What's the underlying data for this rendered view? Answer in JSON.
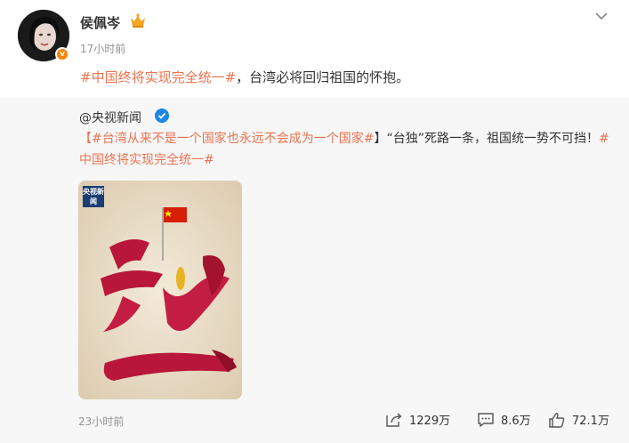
{
  "post": {
    "username": "侯佩岑",
    "time": "17小时前",
    "text_hashtag": "#中国终将实现完全统一#",
    "text_rest": "，台湾必将回归祖国的怀抱。",
    "avatar_badge": "v"
  },
  "repost": {
    "author": "@央视新闻",
    "bracket_open": "【",
    "hashtag1": "#台湾从来不是一个国家也永远不会成为一个国家#",
    "text_mid": "】“台独”死路一条，祖国统一势不可挡！",
    "hashtag2": "#中国终将实现完全统一#",
    "poster_logo": "央视新闻",
    "time": "23小时前",
    "stats": {
      "shares": "1229万",
      "comments": "8.6万",
      "likes": "72.1万"
    }
  },
  "colors": {
    "hashtag": "#eb7350",
    "meta": "#939393",
    "repost_bg": "#f7f7f7",
    "verify": "#1e88e5",
    "badge": "#ff8200"
  },
  "icons": [
    "crown-icon",
    "chevron-down-icon",
    "verified-icon",
    "share-icon",
    "comment-icon",
    "like-icon"
  ]
}
